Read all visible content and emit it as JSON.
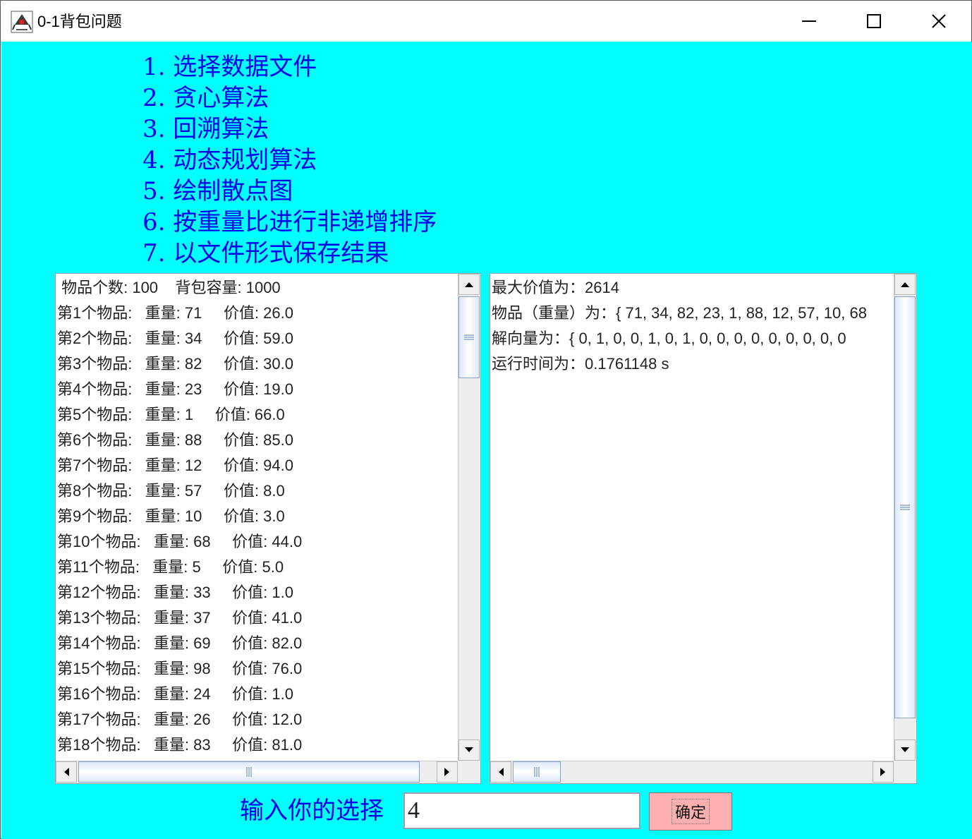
{
  "window": {
    "title": "0-1背包问题"
  },
  "menu": [
    "1. 选择数据文件",
    "2. 贪心算法",
    "3. 回溯算法",
    "4. 动态规划算法",
    "5. 绘制散点图",
    "6. 按重量比进行非递增排序",
    "7. 以文件形式保存结果"
  ],
  "left_pane": {
    "lines": [
      " 物品个数: 100    背包容量: 1000",
      "第1个物品:   重量: 71     价值: 26.0",
      "第2个物品:   重量: 34     价值: 59.0",
      "第3个物品:   重量: 82     价值: 30.0",
      "第4个物品:   重量: 23     价值: 19.0",
      "第5个物品:   重量: 1     价值: 66.0",
      "第6个物品:   重量: 88     价值: 85.0",
      "第7个物品:   重量: 12     价值: 94.0",
      "第8个物品:   重量: 57     价值: 8.0",
      "第9个物品:   重量: 10     价值: 3.0",
      "第10个物品:   重量: 68     价值: 44.0",
      "第11个物品:   重量: 5     价值: 5.0",
      "第12个物品:   重量: 33     价值: 1.0",
      "第13个物品:   重量: 37     价值: 41.0",
      "第14个物品:   重量: 69     价值: 82.0",
      "第15个物品:   重量: 98     价值: 76.0",
      "第16个物品:   重量: 24     价值: 1.0",
      "第17个物品:   重量: 26     价值: 12.0",
      "第18个物品:   重量: 83     价值: 81.0"
    ]
  },
  "right_pane": {
    "lines": [
      "最大价值为：2614",
      "物品（重量）为：{ 71, 34, 82, 23, 1, 88, 12, 57, 10, 68",
      "解向量为：{ 0, 1, 0, 0, 1, 0, 1, 0, 0, 0, 0, 0, 0, 0, 0, 0",
      "运行时间为：0.1761148 s"
    ]
  },
  "bottom": {
    "prompt": "输入你的选择",
    "input_value": "4",
    "confirm_label": "确定"
  },
  "colors": {
    "background": "#00ffff",
    "menu_text": "#0000ee",
    "confirm_button": "#ffafaf"
  },
  "icons": {
    "app": "java-duke-icon",
    "minimize": "minimize-icon",
    "maximize": "maximize-icon",
    "close": "close-icon"
  }
}
